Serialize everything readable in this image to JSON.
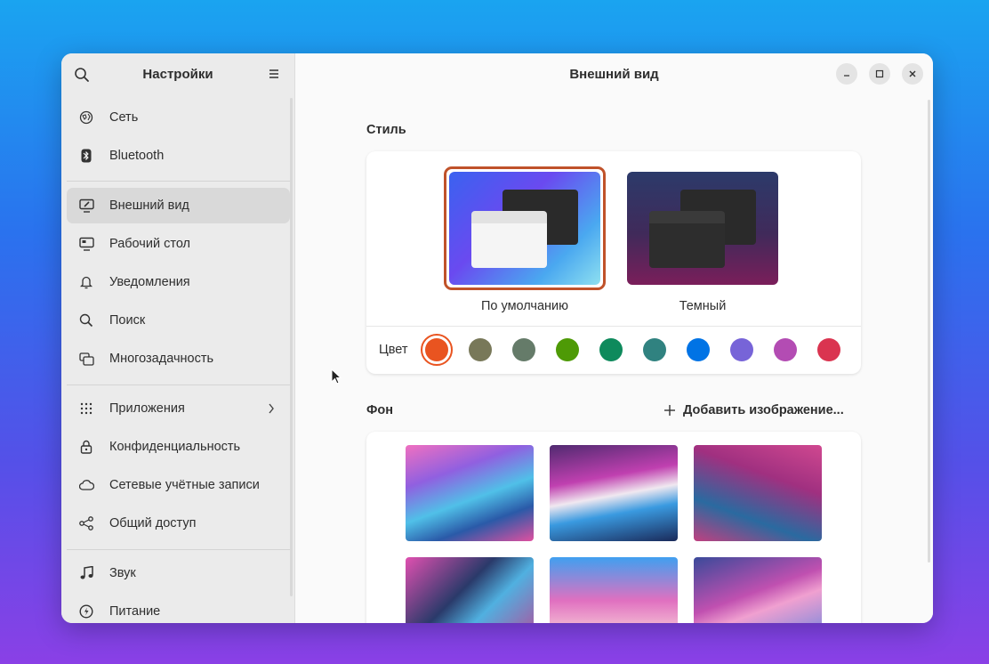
{
  "sidebar": {
    "title": "Настройки",
    "items": [
      {
        "label": "Сеть",
        "icon": "network-icon"
      },
      {
        "label": "Bluetooth",
        "icon": "bluetooth-icon"
      },
      {
        "label": "Внешний вид",
        "icon": "appearance-icon"
      },
      {
        "label": "Рабочий стол",
        "icon": "desktop-icon"
      },
      {
        "label": "Уведомления",
        "icon": "bell-icon"
      },
      {
        "label": "Поиск",
        "icon": "search-icon"
      },
      {
        "label": "Многозадачность",
        "icon": "multitasking-icon"
      },
      {
        "label": "Приложения",
        "icon": "apps-grid-icon"
      },
      {
        "label": "Конфиденциальность",
        "icon": "lock-icon"
      },
      {
        "label": "Сетевые учётные записи",
        "icon": "cloud-icon"
      },
      {
        "label": "Общий доступ",
        "icon": "share-icon"
      },
      {
        "label": "Звук",
        "icon": "music-note-icon"
      },
      {
        "label": "Питание",
        "icon": "power-icon"
      }
    ],
    "active_item": "Внешний вид"
  },
  "main": {
    "title": "Внешний вид",
    "style_section": {
      "label": "Стиль",
      "options": [
        {
          "label": "По умолчанию",
          "selected": true
        },
        {
          "label": "Темный",
          "selected": false
        }
      ],
      "color_label": "Цвет",
      "colors": [
        "#e95420",
        "#787859",
        "#657b69",
        "#4e9a06",
        "#0e8a5c",
        "#308280",
        "#0073e5",
        "#7764d8",
        "#b34cb3",
        "#da3450"
      ],
      "selected_color": "#e95420"
    },
    "background_section": {
      "label": "Фон",
      "add_button_label": "Добавить изображение..."
    }
  }
}
